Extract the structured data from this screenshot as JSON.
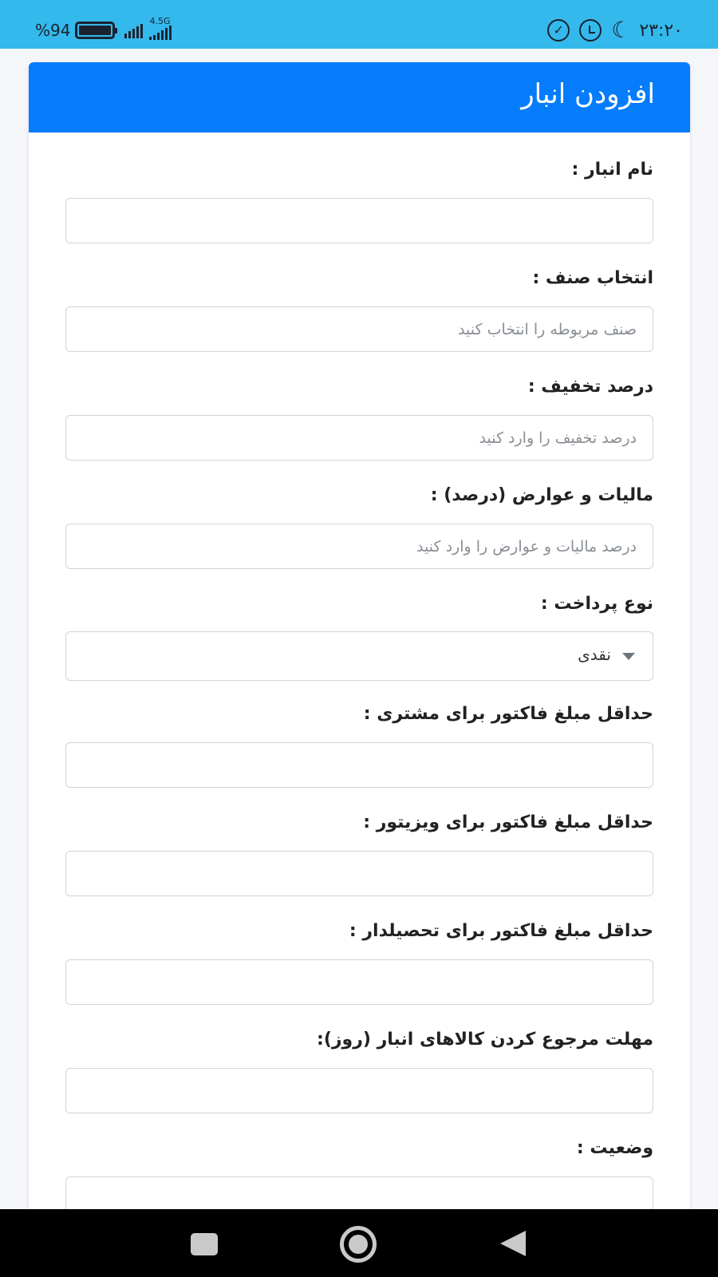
{
  "status_bar": {
    "battery_percent": "%94",
    "network_type": "4.5G",
    "time": "۲۳:۲۰",
    "icons": [
      "battery-icon",
      "signal-icon",
      "check-circle-icon",
      "alarm-icon",
      "moon-icon"
    ],
    "color": "#34b9ec"
  },
  "header": {
    "title": "افزودن انبار",
    "color": "#047cfc"
  },
  "form": {
    "warehouse_name": {
      "label": "نام انبار :",
      "value": "",
      "placeholder": ""
    },
    "category": {
      "label": "انتخاب صنف :",
      "value": "",
      "placeholder": "صنف مربوطه را انتخاب کنید"
    },
    "discount_percent": {
      "label": "درصد تخفیف :",
      "value": "",
      "placeholder": "درصد تخفیف را وارد کنید"
    },
    "tax_percent": {
      "label": "مالیات و عوارض (درصد) :",
      "value": "",
      "placeholder": "درصد مالیات و عوارض را وارد کنید"
    },
    "payment_type": {
      "label": "نوع پرداخت :",
      "selected": "نقدی"
    },
    "min_invoice_customer": {
      "label": "حداقل مبلغ فاکتور برای مشتری :",
      "value": "",
      "placeholder": ""
    },
    "min_invoice_visitor": {
      "label": "حداقل مبلغ فاکتور برای ویزیتور :",
      "value": "",
      "placeholder": ""
    },
    "min_invoice_collector": {
      "label": "حداقل مبلغ فاکتور برای تحصیلدار :",
      "value": "",
      "placeholder": ""
    },
    "return_deadline": {
      "label": "مهلت مرجوع کردن کالاهای انبار (روز):",
      "value": "",
      "placeholder": ""
    },
    "status": {
      "label": "وضعیت :"
    }
  },
  "nav_bar": {
    "buttons": [
      "recents-icon",
      "home-icon",
      "back-icon"
    ]
  }
}
